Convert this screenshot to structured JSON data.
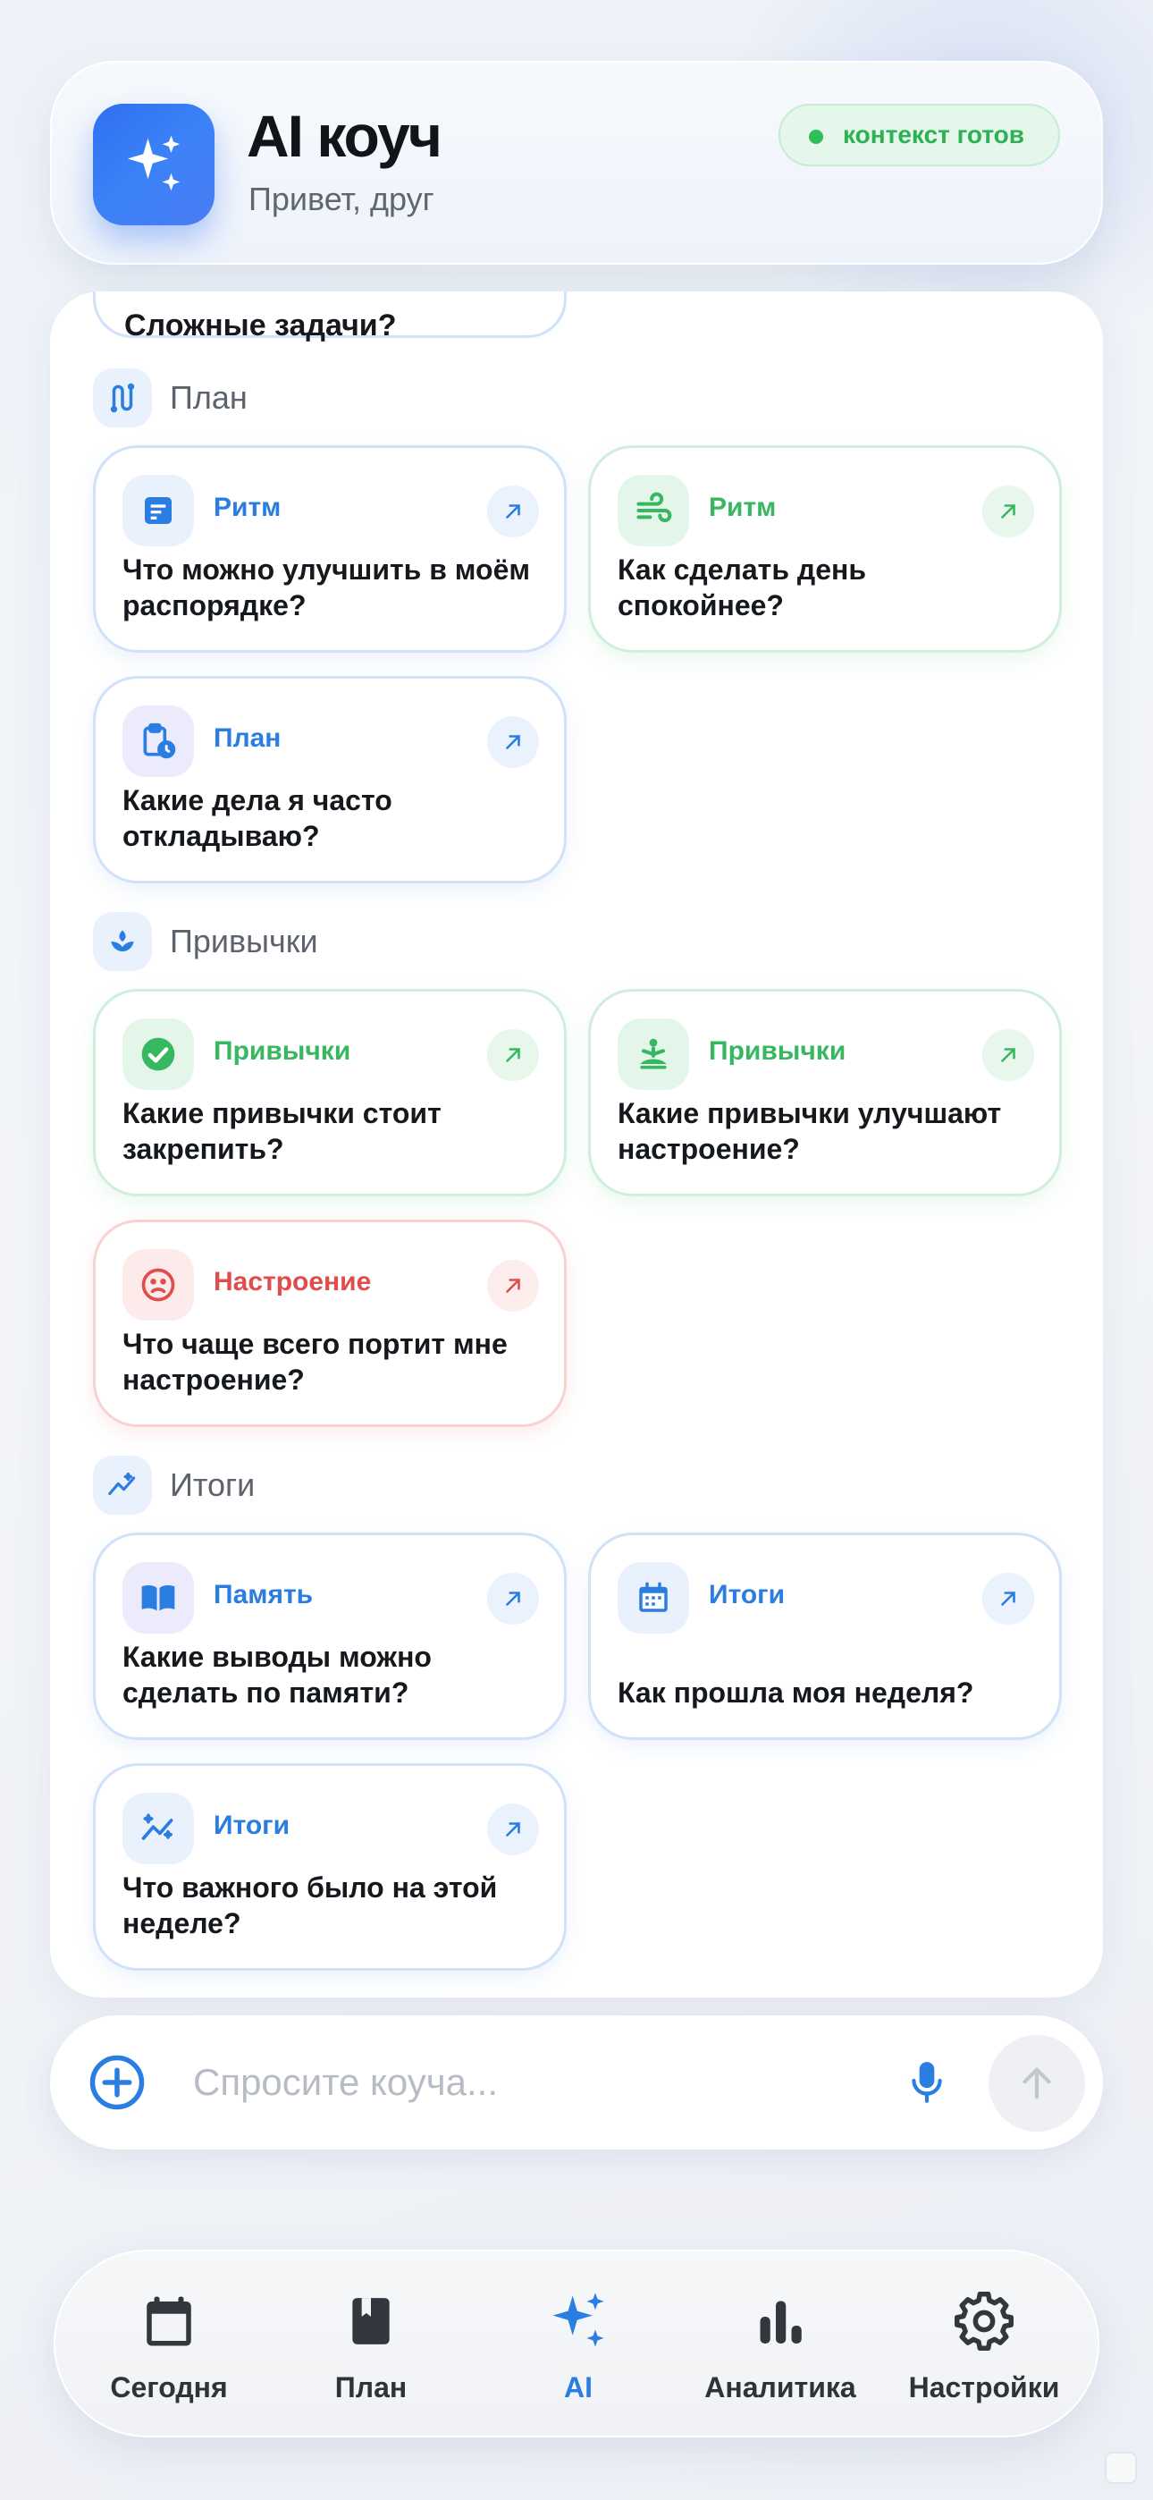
{
  "header": {
    "title": "AI коуч",
    "subtitle": "Привет, друг",
    "status": "контекст готов",
    "app_icon": "sparkles-icon"
  },
  "colors": {
    "accent": "#2f6ff2",
    "blue": "#2a7de1",
    "green": "#37b860",
    "red": "#e14c4c"
  },
  "partial_card_text": "Сложные задачи?",
  "sections": {
    "plan": {
      "label": "План",
      "icon": "route-icon",
      "cards": [
        {
          "tag": "Ритм",
          "icon": "notes-icon",
          "question": "Что можно улучшить в моём распорядке?"
        },
        {
          "tag": "Ритм",
          "icon": "wind-icon",
          "question": "Как сделать день спокойнее?"
        },
        {
          "tag": "План",
          "icon": "clipboard-clock-icon",
          "question": "Какие дела я часто откладываю?"
        }
      ]
    },
    "habits": {
      "label": "Привычки",
      "icon": "sprout-icon",
      "cards": [
        {
          "tag": "Привычки",
          "icon": "check-circle-icon",
          "question": "Какие привычки стоит закрепить?"
        },
        {
          "tag": "Привычки",
          "icon": "meditation-icon",
          "question": "Какие привычки улучшают настроение?"
        },
        {
          "tag": "Настроение",
          "icon": "sad-face-icon",
          "question": "Что чаще всего портит мне настроение?"
        }
      ]
    },
    "summary": {
      "label": "Итоги",
      "icon": "insights-icon",
      "cards": [
        {
          "tag": "Память",
          "icon": "book-icon",
          "question": "Какие выводы можно сделать по памяти?"
        },
        {
          "tag": "Итоги",
          "icon": "calendar-icon",
          "question": "Как прошла моя неделя?"
        },
        {
          "tag": "Итоги",
          "icon": "insights-icon",
          "question": "Что важного было на этой неделе?"
        }
      ]
    }
  },
  "input": {
    "placeholder": "Спросите коуча...",
    "value": ""
  },
  "nav": {
    "items": [
      {
        "label": "Сегодня",
        "icon": "calendar-icon"
      },
      {
        "label": "План",
        "icon": "book-icon"
      },
      {
        "label": "AI",
        "icon": "sparkles-icon",
        "active": true
      },
      {
        "label": "Аналитика",
        "icon": "bar-chart-icon"
      },
      {
        "label": "Настройки",
        "icon": "gear-icon"
      }
    ]
  }
}
